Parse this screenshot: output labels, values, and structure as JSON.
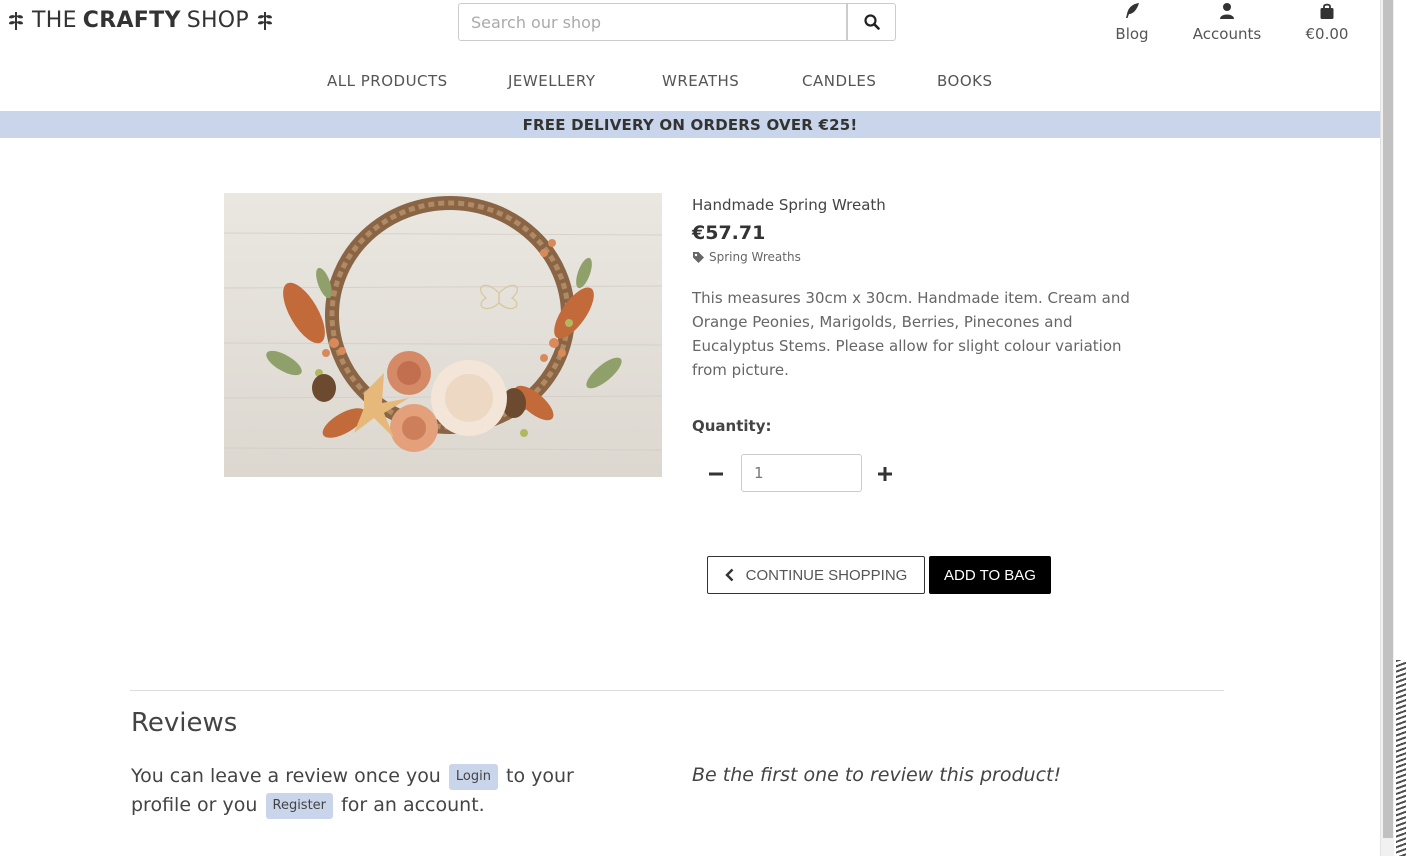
{
  "header": {
    "brand_light_1": "THE",
    "brand_bold": "CRAFTY",
    "brand_light_2": "SHOP",
    "search_placeholder": "Search our shop",
    "links": [
      {
        "label": "Blog",
        "icon": "feather-icon"
      },
      {
        "label": "Accounts",
        "icon": "user-icon"
      },
      {
        "label": "€0.00",
        "icon": "shopping-bag-icon"
      }
    ]
  },
  "nav": {
    "items": [
      "ALL PRODUCTS",
      "JEWELLERY",
      "WREATHS",
      "CANDLES",
      "BOOKS"
    ]
  },
  "banner": {
    "text": "FREE DELIVERY ON ORDERS OVER €25!"
  },
  "product": {
    "name": "Handmade Spring Wreath",
    "price": "€57.71",
    "category": "Spring Wreaths",
    "description": "This measures 30cm x 30cm. Handmade item. Cream and Orange Peonies, Marigolds, Berries, Pinecones and Eucalyptus Stems. Please allow for slight colour variation from picture.",
    "quantity_label": "Quantity:",
    "quantity_value": "1",
    "continue_label": "CONTINUE SHOPPING",
    "add_label": "ADD TO BAG"
  },
  "reviews": {
    "title": "Reviews",
    "msg_part1": "You can leave a review once you",
    "login_label": "Login",
    "msg_part2": "to your profile or you",
    "register_label": "Register",
    "msg_part3": "for an account.",
    "empty_text": "Be the first one to review this product!"
  },
  "colors": {
    "banner_bg": "#c9d5ea",
    "add_button_bg": "#000000",
    "text_dark": "#333333"
  }
}
